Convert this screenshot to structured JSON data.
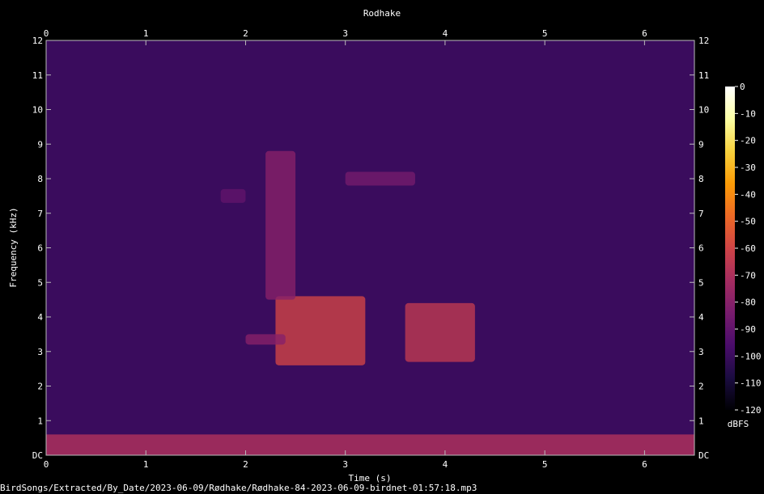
{
  "chart_data": {
    "type": "heatmap",
    "title": "Rodhake",
    "xlabel": "Time (s)",
    "ylabel": "Frequency (kHz)",
    "xlim": [
      0,
      6.5
    ],
    "ylim": [
      0,
      12
    ],
    "x_ticks": [
      "0",
      "1",
      "2",
      "3",
      "4",
      "5",
      "6"
    ],
    "y_ticks": [
      "DC",
      "1",
      "2",
      "3",
      "4",
      "5",
      "6",
      "7",
      "8",
      "9",
      "10",
      "11",
      "12"
    ],
    "colorbar": {
      "label": "dBFS",
      "range": [
        -120,
        0
      ],
      "ticks": [
        "0",
        "-10",
        "-20",
        "-30",
        "-40",
        "-50",
        "-60",
        "-70",
        "-80",
        "-90",
        "-100",
        "-110",
        "-120"
      ],
      "colormap": [
        "#000004",
        "#1b0c41",
        "#4a0c6b",
        "#781c6d",
        "#a52c60",
        "#cf4446",
        "#ed6925",
        "#fb9b06",
        "#f7d13d",
        "#fcffa4",
        "#ffffff"
      ]
    },
    "background_level_dbfs": -100,
    "low_frequency_band": {
      "freq_khz": [
        0,
        0.6
      ],
      "level_dbfs": -70
    },
    "sound_events": [
      {
        "t": [
          2.3,
          3.2
        ],
        "f": [
          2.6,
          4.6
        ],
        "level_dbfs": -60
      },
      {
        "t": [
          2.2,
          2.5
        ],
        "f": [
          4.5,
          8.8
        ],
        "level_dbfs": -80
      },
      {
        "t": [
          3.6,
          4.3
        ],
        "f": [
          2.7,
          4.4
        ],
        "level_dbfs": -65
      },
      {
        "t": [
          2.0,
          2.4
        ],
        "f": [
          3.2,
          3.5
        ],
        "level_dbfs": -80
      },
      {
        "t": [
          3.0,
          3.7
        ],
        "f": [
          7.8,
          8.2
        ],
        "level_dbfs": -85
      },
      {
        "t": [
          1.75,
          2.0
        ],
        "f": [
          7.3,
          7.7
        ],
        "level_dbfs": -90
      }
    ]
  },
  "footer": {
    "file_path": "BirdSongs/Extracted/By_Date/2023-06-09/Rødhake/Rødhake-84-2023-06-09-birdnet-01:57:18.mp3"
  }
}
